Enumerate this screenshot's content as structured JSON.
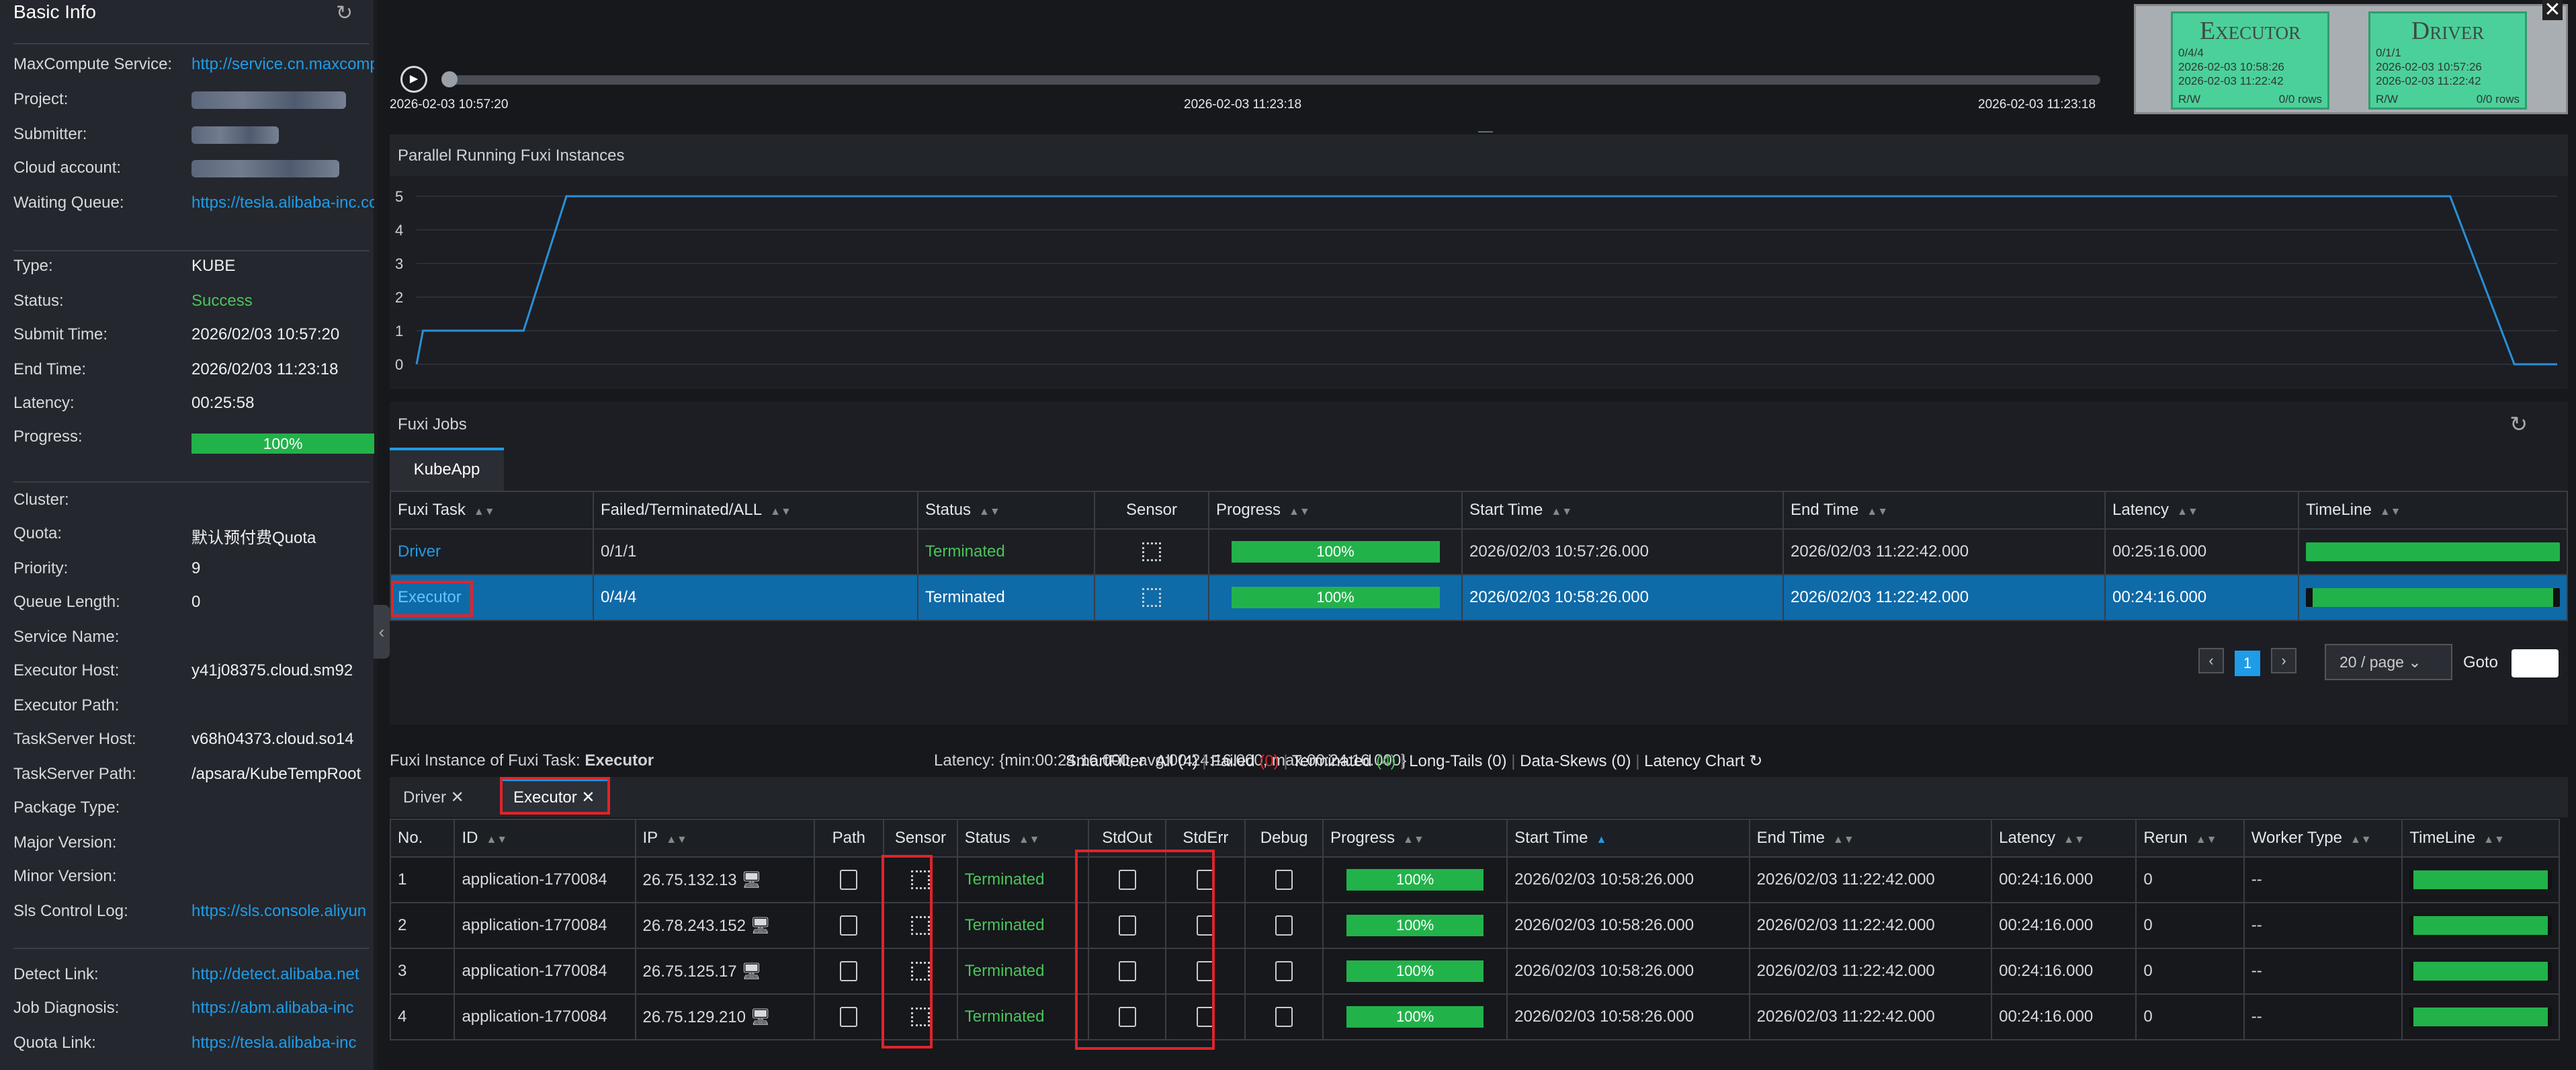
{
  "sidebar": {
    "title": "Basic Info",
    "fields": [
      {
        "label": "MaxCompute Service:",
        "value": "http://service.cn.maxcompute"
      },
      {
        "label": "Project:",
        "value": ""
      },
      {
        "label": "Submitter:",
        "value": ""
      },
      {
        "label": "Cloud account:",
        "value": ""
      },
      {
        "label": "Waiting Queue:",
        "value": "https://tesla.alibaba-inc.com"
      },
      {
        "label": "Type:",
        "value": "KUBE"
      },
      {
        "label": "Status:",
        "value": "Success"
      },
      {
        "label": "Submit Time:",
        "value": "2026/02/03 10:57:20"
      },
      {
        "label": "End Time:",
        "value": "2026/02/03 11:23:18"
      },
      {
        "label": "Latency:",
        "value": "00:25:58"
      },
      {
        "label": "Progress:",
        "value": "100%"
      },
      {
        "label": "Cluster:",
        "value": ""
      },
      {
        "label": "Quota:",
        "value": "默认预付费Quota"
      },
      {
        "label": "Priority:",
        "value": "9"
      },
      {
        "label": "Queue Length:",
        "value": "0"
      },
      {
        "label": "Service Name:",
        "value": ""
      },
      {
        "label": "Executor Host:",
        "value": "y41j08375.cloud.sm92"
      },
      {
        "label": "Executor Path:",
        "value": ""
      },
      {
        "label": "TaskServer Host:",
        "value": "v68h04373.cloud.so14"
      },
      {
        "label": "TaskServer Path:",
        "value": "/apsara/KubeTempRoot"
      },
      {
        "label": "Package Type:",
        "value": ""
      },
      {
        "label": "Major Version:",
        "value": ""
      },
      {
        "label": "Minor Version:",
        "value": ""
      },
      {
        "label": "Sls Control Log:",
        "value": "https://sls.console.aliyun"
      },
      {
        "label": "Detect Link:",
        "value": "http://detect.alibaba.net"
      },
      {
        "label": "Job Diagnosis:",
        "value": "https://abm.alibaba-inc"
      },
      {
        "label": "Quota Link:",
        "value": "https://tesla.alibaba-inc"
      }
    ]
  },
  "timeline": {
    "start": "2026-02-03 10:57:20",
    "mid": "2026-02-03 11:23:18",
    "end": "2026-02-03 11:23:18"
  },
  "minimap": {
    "executor": {
      "title": "Executor",
      "count": "0/4/4",
      "start": "2026-02-03 10:58:26",
      "end": "2026-02-03 11:22:42",
      "rw": "R/W",
      "rows": "0/0 rows"
    },
    "driver": {
      "title": "Driver",
      "count": "0/1/1",
      "start": "2026-02-03 10:57:26",
      "end": "2026-02-03 11:22:42",
      "rw": "R/W",
      "rows": "0/0 rows"
    }
  },
  "chart_data": {
    "type": "line",
    "title": "Parallel Running Fuxi Instances",
    "yticks": [
      "5",
      "4",
      "3",
      "2",
      "1",
      "0"
    ],
    "ylim": [
      0,
      5
    ],
    "x": [
      0,
      0.003,
      0.005,
      0.05,
      0.07,
      0.95,
      0.98,
      1.0
    ],
    "values": [
      0,
      1,
      1,
      1,
      5,
      5,
      0,
      0
    ]
  },
  "jobs": {
    "title": "Fuxi Jobs",
    "tab": "KubeApp",
    "headers": [
      "Fuxi Task",
      "Failed/Terminated/ALL",
      "Status",
      "Sensor",
      "Progress",
      "Start Time",
      "End Time",
      "Latency",
      "TimeLine"
    ],
    "rows": [
      {
        "task": "Driver",
        "fta": "0/1/1",
        "status": "Terminated",
        "progress": "100%",
        "start": "2026/02/03 10:57:26.000",
        "end": "2026/02/03 11:22:42.000",
        "latency": "00:25:16.000"
      },
      {
        "task": "Executor",
        "fta": "0/4/4",
        "status": "Terminated",
        "progress": "100%",
        "start": "2026/02/03 10:58:26.000",
        "end": "2026/02/03 11:22:42.000",
        "latency": "00:24:16.000"
      }
    ],
    "pager": {
      "page": "1",
      "size": "20 / page",
      "goto": "Goto"
    }
  },
  "instances": {
    "title_prefix": "Fuxi Instance of Fuxi Task:",
    "task": "Executor",
    "latency": "Latency: {min:00:24:16.000, avg:00:24:16.000, max:00:24:16.000}",
    "filters": {
      "smart": "SmartFilter",
      "all": "All",
      "all_n": "(4)",
      "failed": "Failed",
      "failed_n": "(0)",
      "term": "Terminated",
      "term_n": "(4)",
      "long": "Long-Tails",
      "long_n": "(0)",
      "skew": "Data-Skews",
      "skew_n": "(0)",
      "chart": "Latency Chart"
    },
    "tabs": [
      "Driver",
      "Executor"
    ],
    "headers": [
      "No.",
      "ID",
      "IP",
      "Path",
      "Sensor",
      "Status",
      "StdOut",
      "StdErr",
      "Debug",
      "Progress",
      "Start Time",
      "End Time",
      "Latency",
      "Rerun",
      "Worker Type",
      "TimeLine"
    ],
    "rows": [
      {
        "no": "1",
        "id": "application-1770084",
        "ip": "26.75.132.13",
        "status": "Terminated",
        "progress": "100%",
        "start": "2026/02/03 10:58:26.000",
        "end": "2026/02/03 11:22:42.000",
        "latency": "00:24:16.000",
        "rerun": "0",
        "worker": "--"
      },
      {
        "no": "2",
        "id": "application-1770084",
        "ip": "26.78.243.152",
        "status": "Terminated",
        "progress": "100%",
        "start": "2026/02/03 10:58:26.000",
        "end": "2026/02/03 11:22:42.000",
        "latency": "00:24:16.000",
        "rerun": "0",
        "worker": "--"
      },
      {
        "no": "3",
        "id": "application-1770084",
        "ip": "26.75.125.17",
        "status": "Terminated",
        "progress": "100%",
        "start": "2026/02/03 10:58:26.000",
        "end": "2026/02/03 11:22:42.000",
        "latency": "00:24:16.000",
        "rerun": "0",
        "worker": "--"
      },
      {
        "no": "4",
        "id": "application-1770084",
        "ip": "26.75.129.210",
        "status": "Terminated",
        "progress": "100%",
        "start": "2026/02/03 10:58:26.000",
        "end": "2026/02/03 11:22:42.000",
        "latency": "00:24:16.000",
        "rerun": "0",
        "worker": "--"
      }
    ]
  },
  "colors": {
    "accent": "#1f9ce8",
    "success": "#22b24a",
    "failed": "#e0242a",
    "selected": "#0f6aa8"
  }
}
